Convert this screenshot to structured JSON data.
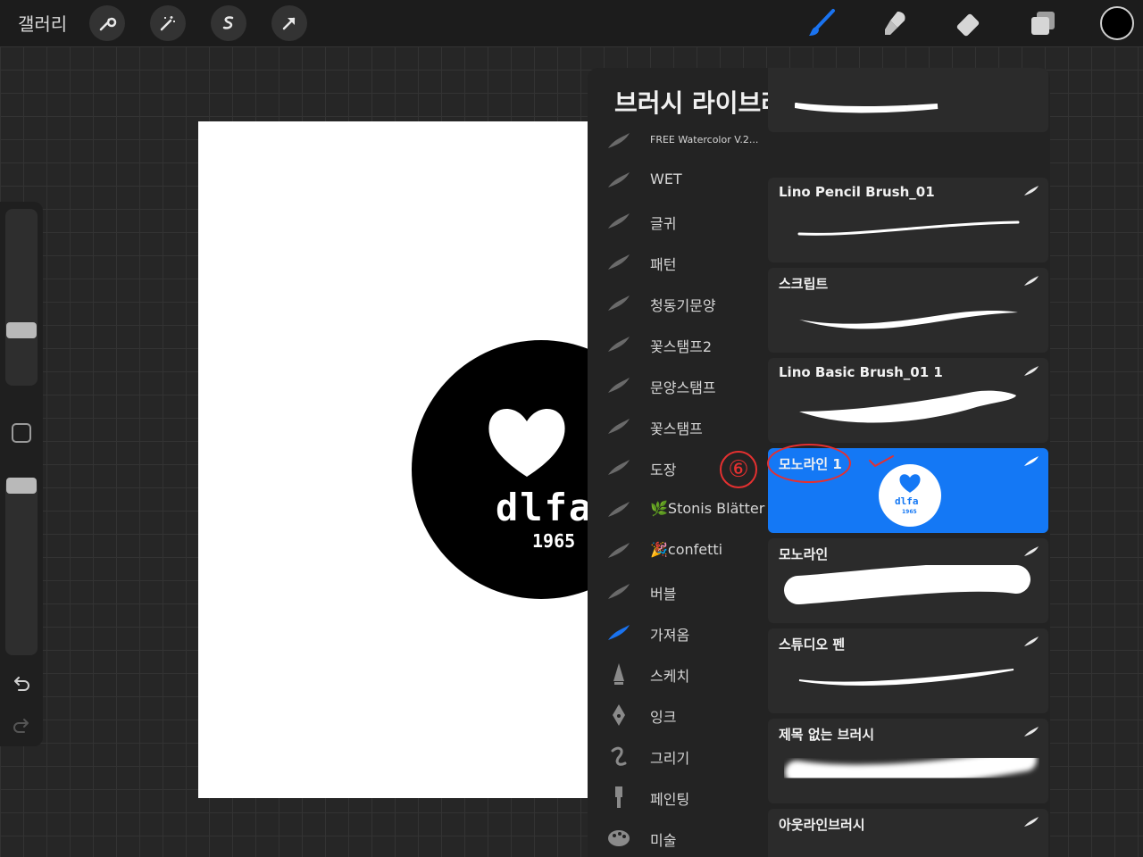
{
  "toolbar": {
    "gallery_label": "갤러리",
    "icons": [
      "wrench-icon",
      "magic-wand-icon",
      "selection-icon",
      "transform-arrow-icon",
      "brush-icon",
      "smudge-icon",
      "eraser-icon",
      "layers-icon"
    ],
    "current_color": "#000000",
    "active_color": "#1a73f0"
  },
  "canvas": {
    "logo_text": "dlfa",
    "logo_year": "1965"
  },
  "brush_library": {
    "title": "브러시 라이브러리",
    "categories": [
      {
        "label": "FREE Watercolor V.2..."
      },
      {
        "label": "WET"
      },
      {
        "label": "글귀"
      },
      {
        "label": "패턴"
      },
      {
        "label": "청동기문양"
      },
      {
        "label": "꽃스탬프2"
      },
      {
        "label": "문양스탬프"
      },
      {
        "label": "꽃스탬프"
      },
      {
        "label": "도장"
      },
      {
        "label": "🌿Stonis Blätter"
      },
      {
        "label": "🎉confetti"
      },
      {
        "label": "버블"
      },
      {
        "label": "가져옴"
      },
      {
        "label": "스케치"
      },
      {
        "label": "잉크"
      },
      {
        "label": "그리기"
      },
      {
        "label": "페인팅"
      },
      {
        "label": "미술"
      }
    ],
    "brushes": [
      {
        "name": ""
      },
      {
        "name": "Lino Pencil Brush_01"
      },
      {
        "name": "스크립트"
      },
      {
        "name": "Lino Basic Brush_01 1"
      },
      {
        "name": "모노라인 1"
      },
      {
        "name": "모노라인"
      },
      {
        "name": "스튜디오 펜"
      },
      {
        "name": "제목 없는 브러시"
      },
      {
        "name": "아웃라인브러시"
      }
    ],
    "selected_brush": "모노라인 1",
    "stamp_preview_text": "dlfa",
    "stamp_preview_year": "1965"
  },
  "annotation": {
    "step_number": "⑥"
  }
}
